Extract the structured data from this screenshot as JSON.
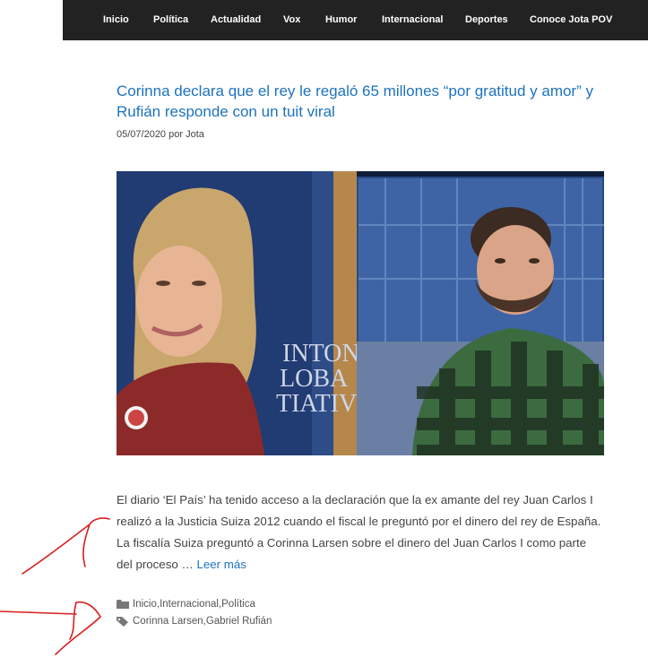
{
  "nav": {
    "items": [
      "Inicio",
      "Política",
      "Actualidad",
      "Vox",
      "Humor",
      "Internacional",
      "Deportes",
      "Conoce Jota POV"
    ]
  },
  "post": {
    "title": "Corinna declara que el rey le regaló 65 millones “por gratitud y amor” y Rufián responde con un tuit viral",
    "date": "05/07/2020",
    "by": "por",
    "author": "Jota",
    "image_left_text": [
      "INTON",
      "LOBA",
      "TIATIV"
    ],
    "excerpt": "El diario ‘El País’ ha tenido acceso a la declaración que la ex amante del rey Juan Carlos I realizó a la Justicia Suiza 2012 cuando el fiscal le preguntó por el dinero del rey de España. La fiscalía Suiza preguntó a Corinna Larsen sobre el dinero del Juan Carlos I como parte del proceso …",
    "read_more": "Leer más",
    "categories": [
      "Inicio",
      "Internacional",
      "Política"
    ],
    "tags": [
      "Corinna Larsen",
      "Gabriel Rufián"
    ],
    "separator": ", "
  },
  "colors": {
    "nav_bg": "#222222",
    "link": "#1e73be",
    "annotation": "#d81e1e"
  },
  "icons": [
    "folder-icon",
    "tag-icon"
  ]
}
